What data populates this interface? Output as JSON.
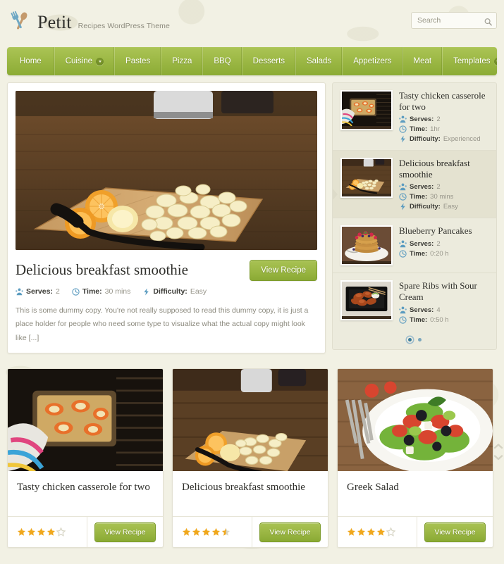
{
  "header": {
    "logo_icon": "fork-spoon-icon",
    "site_title": "Petit",
    "tagline": "Recipes WordPress Theme",
    "search": {
      "placeholder": "Search",
      "value": "",
      "icon": "search-icon"
    }
  },
  "nav": {
    "items": [
      {
        "label": "Home",
        "has_dropdown": false
      },
      {
        "label": "Cuisine",
        "has_dropdown": true
      },
      {
        "label": "Pastes",
        "has_dropdown": false
      },
      {
        "label": "Pizza",
        "has_dropdown": false
      },
      {
        "label": "BBQ",
        "has_dropdown": false
      },
      {
        "label": "Desserts",
        "has_dropdown": false
      },
      {
        "label": "Salads",
        "has_dropdown": false
      },
      {
        "label": "Appetizers",
        "has_dropdown": false
      },
      {
        "label": "Meat",
        "has_dropdown": false
      },
      {
        "label": "Templates",
        "has_dropdown": true
      }
    ]
  },
  "featured": {
    "image_alt": "sliced-bananas-and-oranges-on-cutting-board",
    "title": "Delicious breakfast smoothie",
    "view_button": "View Recipe",
    "meta": [
      {
        "icon": "serves-icon",
        "label": "Serves:",
        "value": "2"
      },
      {
        "icon": "clock-icon",
        "label": "Time:",
        "value": "30 mins"
      },
      {
        "icon": "bolt-icon",
        "label": "Difficulty:",
        "value": "Easy"
      }
    ],
    "excerpt": "This is some dummy copy. You're not really supposed to read this dummy copy, it is just a place holder for people who need some type to visualize what the actual copy might look like [...]"
  },
  "sidebar": {
    "items": [
      {
        "title": "Tasty chicken casserole for two",
        "image_alt": "chicken-casserole-in-oven",
        "active": false,
        "meta": [
          {
            "icon": "serves-icon",
            "label": "Serves:",
            "value": "2"
          },
          {
            "icon": "clock-icon",
            "label": "Time:",
            "value": "1hr"
          },
          {
            "icon": "bolt-icon",
            "label": "Difficulty:",
            "value": "Experienced"
          }
        ]
      },
      {
        "title": "Delicious breakfast smoothie",
        "image_alt": "sliced-bananas-and-oranges-on-cutting-board",
        "active": true,
        "meta": [
          {
            "icon": "serves-icon",
            "label": "Serves:",
            "value": "2"
          },
          {
            "icon": "clock-icon",
            "label": "Time:",
            "value": "30 mins"
          },
          {
            "icon": "bolt-icon",
            "label": "Difficulty:",
            "value": "Easy"
          }
        ]
      },
      {
        "title": "Blueberry Pancakes",
        "image_alt": "pancake-stack-with-berries",
        "active": false,
        "meta": [
          {
            "icon": "serves-icon",
            "label": "Serves:",
            "value": "2"
          },
          {
            "icon": "clock-icon",
            "label": "Time:",
            "value": "0:20 h"
          }
        ]
      },
      {
        "title": "Spare Ribs with Sour Cream",
        "image_alt": "spare-ribs-on-black-tray",
        "active": false,
        "meta": [
          {
            "icon": "serves-icon",
            "label": "Serves:",
            "value": "4"
          },
          {
            "icon": "clock-icon",
            "label": "Time:",
            "value": "0:50 h"
          }
        ]
      }
    ],
    "pagination": {
      "total": 2,
      "active_index": 0
    }
  },
  "cards": [
    {
      "title": "Tasty chicken casserole for two",
      "image_alt": "chicken-casserole-in-oven",
      "rating": 4,
      "rating_max": 5,
      "button": "View Recipe"
    },
    {
      "title": "Delicious breakfast smoothie",
      "image_alt": "sliced-bananas-and-oranges-on-cutting-board",
      "rating": 4.5,
      "rating_max": 5,
      "button": "View Recipe"
    },
    {
      "title": "Greek Salad",
      "image_alt": "greek-salad-on-white-plate",
      "rating": 4,
      "rating_max": 5,
      "button": "View Recipe"
    }
  ],
  "scroll_nav": {
    "up_icon": "chevron-up-icon",
    "down_icon": "chevron-down-icon"
  },
  "colors": {
    "page_bg": "#f2f1e4",
    "nav_green_top": "#abc455",
    "nav_green_bottom": "#8bab35",
    "button_green": "#9bb744",
    "star_gold": "#f0a81e",
    "star_empty": "#d8d6c6",
    "sidebar_bg": "#ecebdd",
    "sidebar_active_bg": "#e4e2d0",
    "text_dark": "#2f2f2b",
    "text_muted": "#8c8a7e",
    "icon_blue": "#5c9cc0"
  }
}
